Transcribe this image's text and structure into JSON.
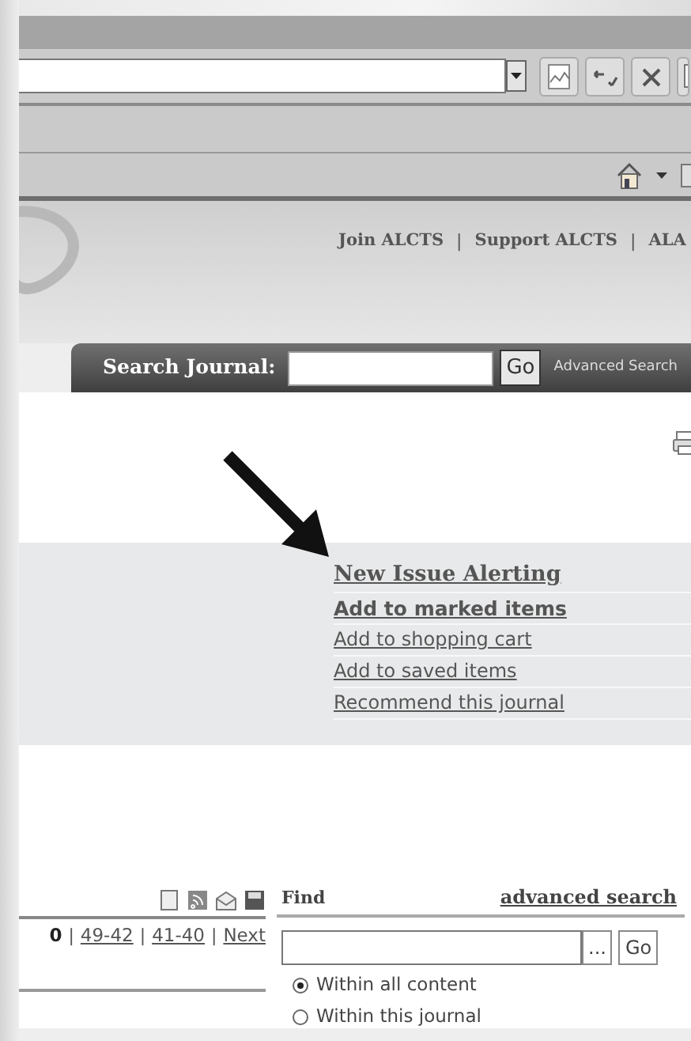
{
  "header_links": {
    "separator": "|",
    "items": [
      "Join ALCTS",
      "Support ALCTS",
      "ALA"
    ]
  },
  "journal_search": {
    "label": "Search Journal:",
    "button": "Go",
    "link": "Advanced Search"
  },
  "actions": [
    {
      "label": "New Issue Alerting",
      "kind": "headline"
    },
    {
      "label": "Add to marked items",
      "kind": "bold"
    },
    {
      "label": "Add to shopping cart",
      "kind": "plain"
    },
    {
      "label": "Add to saved items",
      "kind": "plain"
    },
    {
      "label": "Recommend this journal",
      "kind": "plain"
    }
  ],
  "pagination": {
    "separator": "|",
    "pages": [
      {
        "label": "0",
        "selected": true
      },
      {
        "label": "49-42",
        "selected": false
      },
      {
        "label": "41-40",
        "selected": false
      },
      {
        "label": "Next",
        "selected": false
      }
    ]
  },
  "find": {
    "title": "Find",
    "link": "advanced search",
    "browse_button": "...",
    "button": "Go",
    "options": [
      {
        "label": "Within all content",
        "selected": true
      },
      {
        "label": "Within this journal",
        "selected": false
      }
    ]
  }
}
